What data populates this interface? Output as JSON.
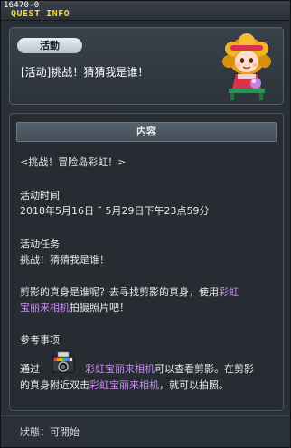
{
  "window": {
    "quest_id": "16470-0",
    "title": "QUEST INFO"
  },
  "header": {
    "category": "活動",
    "quest_title": "[活动]挑战！猜猜我是谁！"
  },
  "content": {
    "section_title": "内容",
    "subtitle": "<挑战！冒险岛彩虹！>",
    "time_label": "活动时间",
    "time_value": "2018年5月16日 ˜ 5月29日下午23点59分",
    "task_label": "活动任务",
    "task_value": "挑战！猜猜我是谁！",
    "desc_line1_a": "剪影的真身是谁呢？去寻找剪影的真身，使用",
    "desc_line1_b": "彩虹",
    "desc_line2_a": "宝丽来相机",
    "desc_line2_b": "拍摄照片吧！",
    "notes_label": "参考事项",
    "note_line1_a": "通过",
    "note_line1_item": "彩虹宝丽来相机",
    "note_line1_b": "可以查看剪影。在剪影",
    "note_line2_a": "的真身附近双击",
    "note_line2_item": "彩虹宝丽来相机",
    "note_line2_b": "，就可以拍照。"
  },
  "status": {
    "text": "狀態：可開始"
  },
  "colors": {
    "title_yellow": "#f4d63a",
    "item_highlight": "#c98cf0",
    "panel_bg": "#262c32"
  },
  "icons": {
    "npc": "npc-portrait-icon",
    "camera": "polaroid-camera-icon"
  }
}
